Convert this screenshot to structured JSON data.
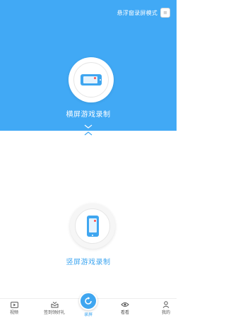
{
  "header": {
    "float_mode_label": "悬浮窗录屏模式",
    "toggle_icon": "switch-icon"
  },
  "landscape": {
    "label": "横屏游戏录制",
    "icon": "phone-landscape-icon"
  },
  "portrait": {
    "label": "竖屏游戏录制",
    "icon": "phone-portrait-icon"
  },
  "nav": {
    "items": [
      {
        "label": "视频",
        "icon": "play-tv-icon"
      },
      {
        "label": "签到领好礼",
        "icon": "gift-icon"
      },
      {
        "label": "录屏",
        "icon": "record-icon"
      },
      {
        "label": "看看",
        "icon": "eye-icon"
      },
      {
        "label": "我的",
        "icon": "user-icon"
      }
    ]
  },
  "colors": {
    "primary": "#41a9f5",
    "accent": "#3fa6f0",
    "record_dot": "#ff4d4f"
  }
}
